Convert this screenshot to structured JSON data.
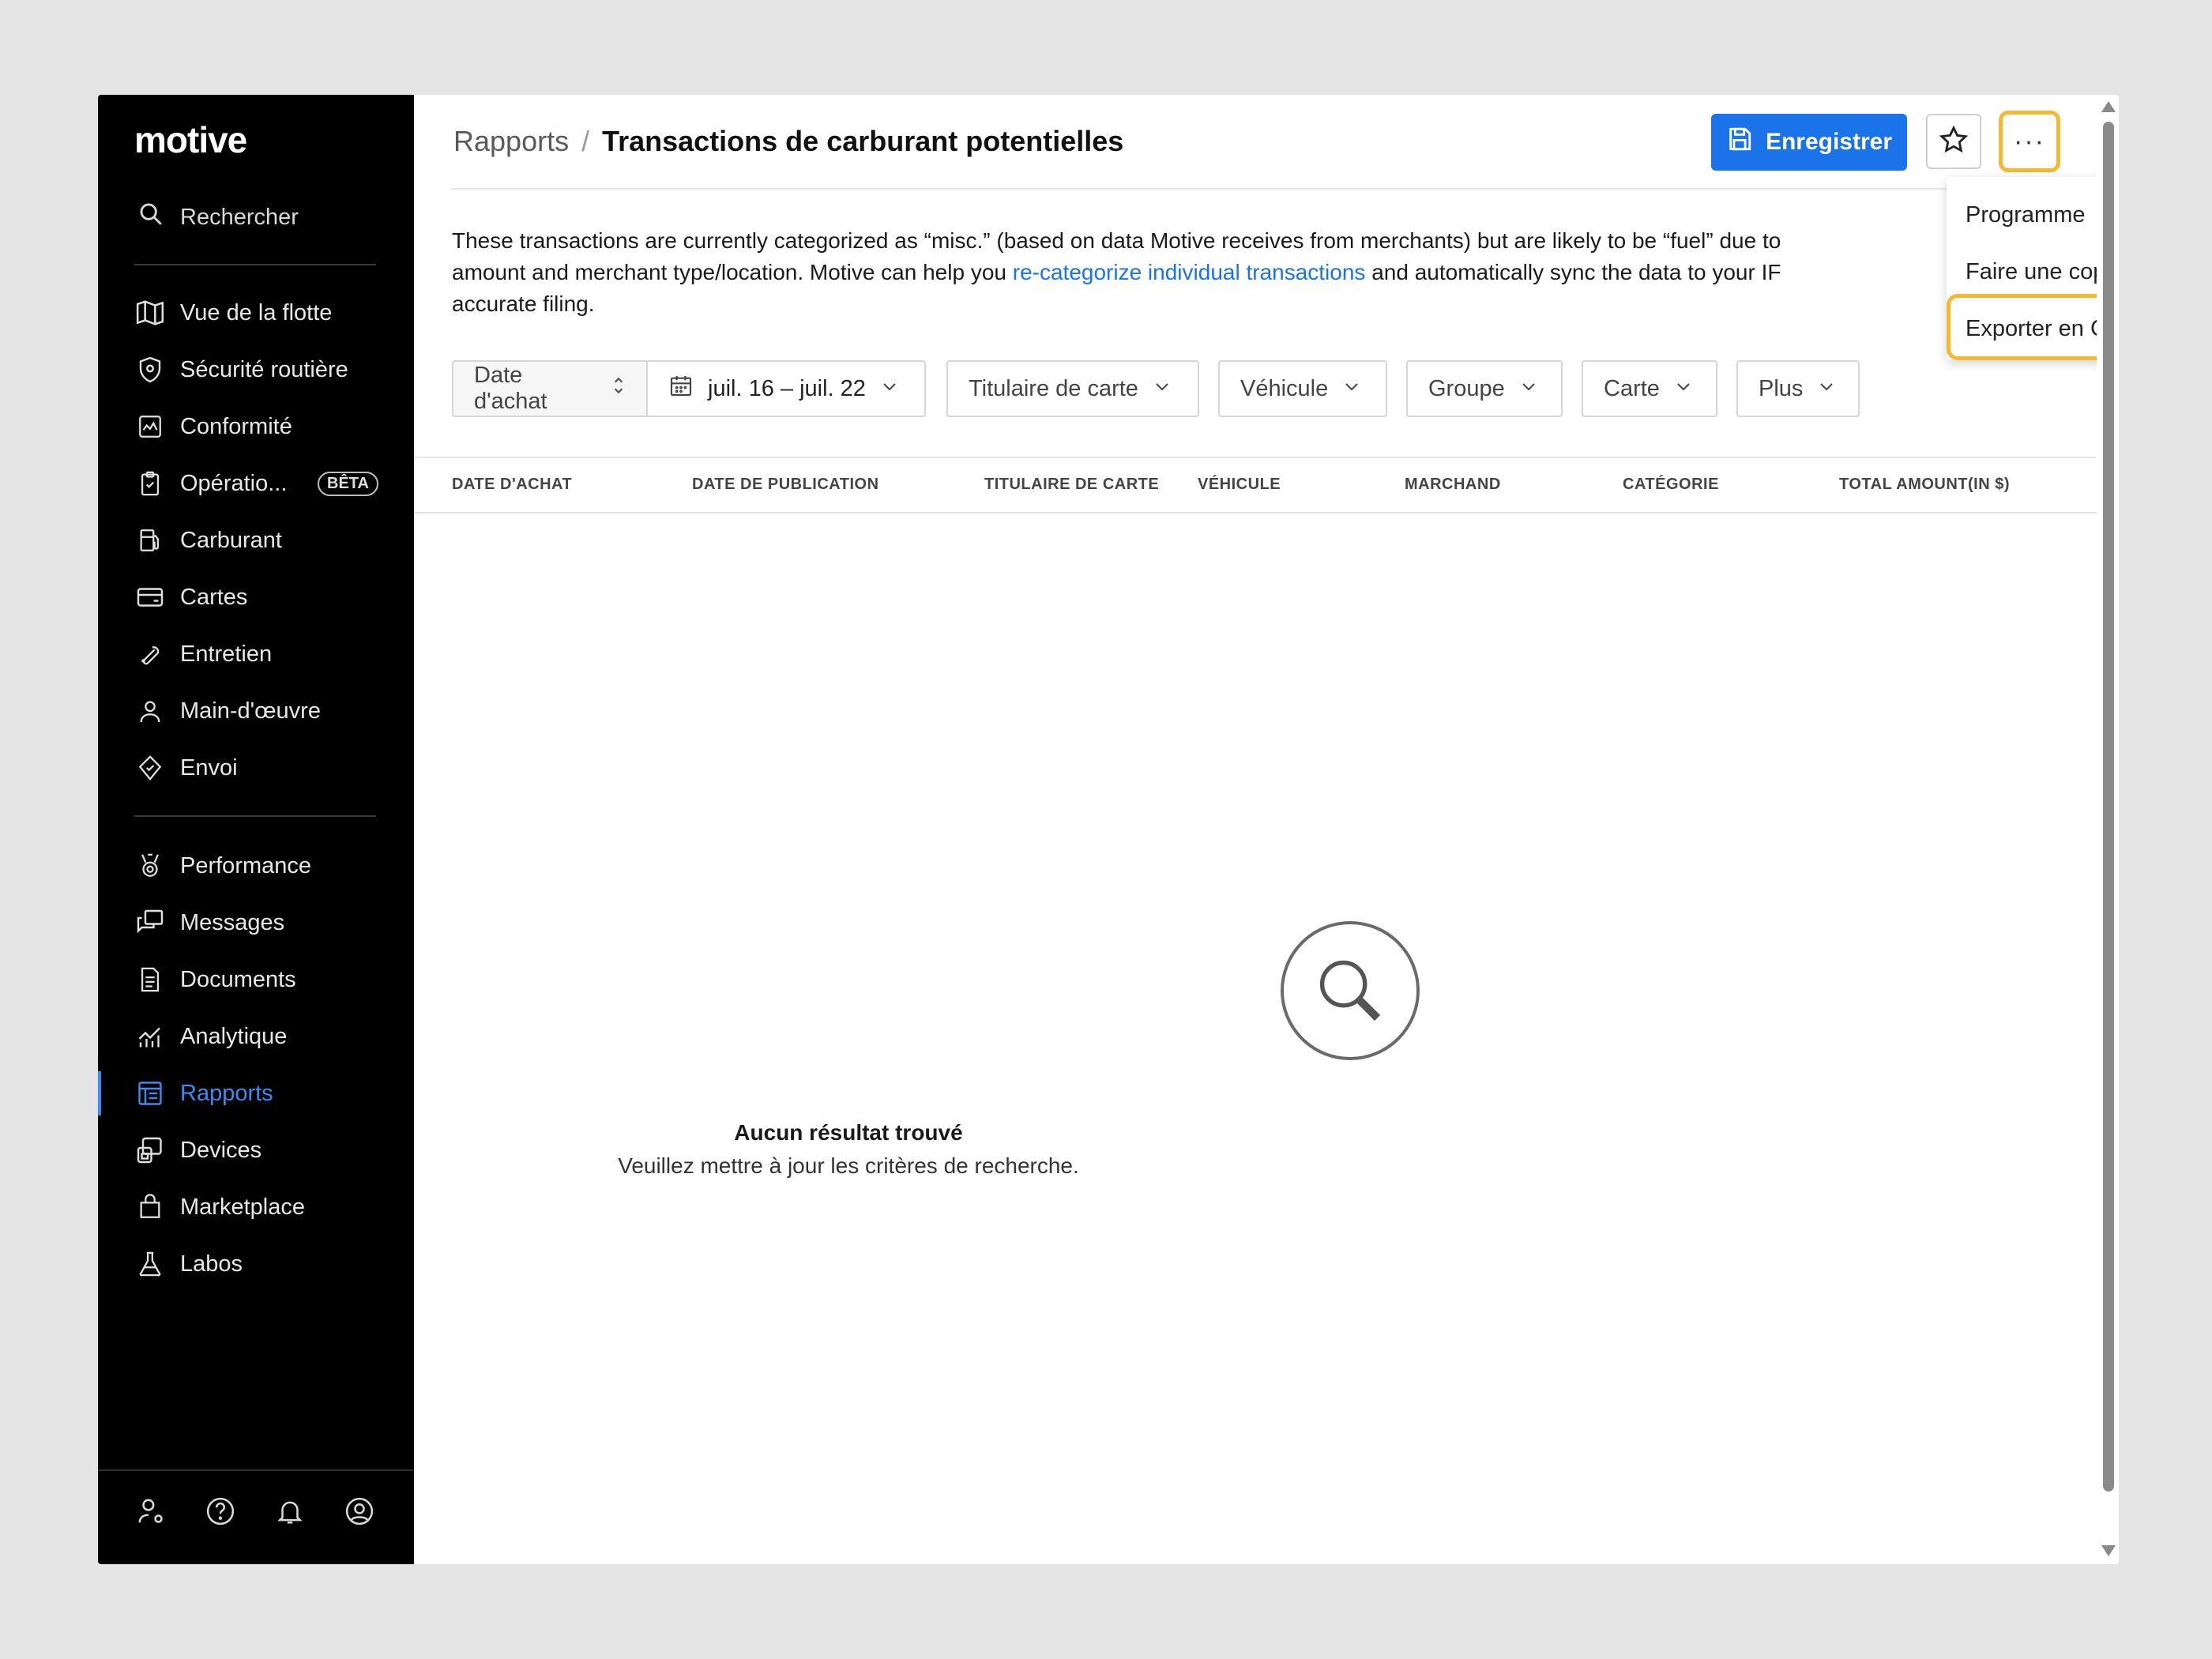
{
  "brand": {
    "logo": "motive"
  },
  "sidebar": {
    "search_label": "Rechercher",
    "group1": [
      {
        "label": "Vue de la flotte",
        "icon": "map-icon"
      },
      {
        "label": "Sécurité routière",
        "icon": "shield-icon"
      },
      {
        "label": "Conformité",
        "icon": "compliance-icon"
      },
      {
        "label": "Opératio...",
        "icon": "clipboard-icon",
        "badge": "BÊTA"
      },
      {
        "label": "Carburant",
        "icon": "fuel-pump-icon"
      },
      {
        "label": "Cartes",
        "icon": "card-icon"
      },
      {
        "label": "Entretien",
        "icon": "wrench-icon"
      },
      {
        "label": "Main-d'œuvre",
        "icon": "person-icon"
      },
      {
        "label": "Envoi",
        "icon": "dispatch-icon"
      }
    ],
    "group2": [
      {
        "label": "Performance",
        "icon": "medal-icon"
      },
      {
        "label": "Messages",
        "icon": "messages-icon"
      },
      {
        "label": "Documents",
        "icon": "document-icon"
      },
      {
        "label": "Analytique",
        "icon": "analytics-icon"
      },
      {
        "label": "Rapports",
        "icon": "reports-icon",
        "active": true
      },
      {
        "label": "Devices",
        "icon": "devices-icon"
      },
      {
        "label": "Marketplace",
        "icon": "bag-icon"
      },
      {
        "label": "Labos",
        "icon": "flask-icon"
      }
    ],
    "bottom_icons": [
      "user-settings-icon",
      "help-icon",
      "bell-icon",
      "account-icon"
    ]
  },
  "header": {
    "breadcrumb_root": "Rapports",
    "breadcrumb_sep": "/",
    "title": "Transactions de carburant potentielles",
    "save_label": "Enregistrer",
    "more_label": "···"
  },
  "description": {
    "line1": "These transactions are currently categorized as “misc.” (based on data Motive receives from merchants) but are likely to be “fuel” due to",
    "line2_pre": "amount and merchant type/location. Motive can help you ",
    "link": "re-categorize individual transactions",
    "line2_post": " and automatically sync the data to your IF",
    "line3": "accurate filing."
  },
  "filters": {
    "sort_label": "Date d'achat",
    "date_range": "juil. 16 – juil. 22",
    "cardholder": "Titulaire de carte",
    "vehicle": "Véhicule",
    "group": "Groupe",
    "card": "Carte",
    "more": "Plus"
  },
  "table": {
    "columns": [
      "DATE D'ACHAT",
      "DATE DE PUBLICATION",
      "TITULAIRE DE CARTE",
      "VÉHICULE",
      "MARCHAND",
      "CATÉGORIE",
      "TOTAL AMOUNT(IN $)"
    ]
  },
  "empty_state": {
    "title": "Aucun résultat trouvé",
    "subtitle": "Veuillez mettre à jour les critères de recherche."
  },
  "dropdown": {
    "items": [
      "Programme",
      "Faire une copie",
      "Exporter en CSV"
    ],
    "highlight_color": "#f5b82e"
  },
  "colors": {
    "accent": "#1a73e8",
    "sidebar_bg": "#000000",
    "active_nav": "#3b8bf0"
  }
}
